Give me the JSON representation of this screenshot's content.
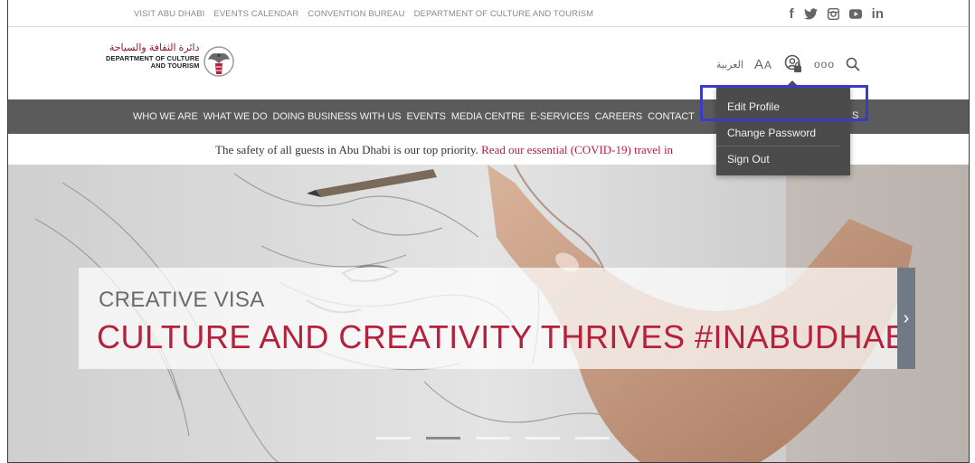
{
  "topbar": {
    "links": [
      "VISIT ABU DHABI",
      "EVENTS CALENDAR",
      "CONVENTION BUREAU",
      "DEPARTMENT OF CULTURE AND TOURISM"
    ],
    "social_icons": [
      "facebook-icon",
      "twitter-icon",
      "instagram-icon",
      "youtube-icon",
      "linkedin-icon"
    ],
    "linkedin_label": "in",
    "facebook_label": "f"
  },
  "header": {
    "logo": {
      "arabic": "دائرة الثقافة والسياحة",
      "line1": "DEPARTMENT OF CULTURE",
      "line2": "AND TOURISM"
    },
    "language": "العربية",
    "font_size_label_large": "A",
    "font_size_label_small": "A",
    "more_label": "ooo"
  },
  "nav": {
    "items": [
      "WHO WE ARE",
      "WHAT WE DO",
      "DOING BUSINESS WITH US",
      "EVENTS",
      "MEDIA CENTRE",
      "E-SERVICES",
      "CAREERS",
      "CONTACT US",
      "ACCESSIBILITY OPTIONS"
    ],
    "visible_fragments": {
      "contact_partial": "CONTACT",
      "last_partial": "S"
    }
  },
  "notice": {
    "text": "The safety of all guests in Abu Dhabi is our top priority. ",
    "link": "Read our essential (COVID-19) travel in"
  },
  "hero": {
    "subtitle": "CREATIVE VISA",
    "title": "CULTURE AND CREATIVITY THRIVES #INABUDHABI",
    "next_arrow": "›",
    "slides": 5,
    "active_slide": 2
  },
  "user_menu": {
    "items": [
      "Edit Profile",
      "Change Password",
      "Sign Out"
    ],
    "highlighted": "Edit Profile"
  },
  "colors": {
    "brand_red": "#b5203a",
    "nav_bg": "#5b5b5b",
    "dropdown_bg": "#4b4b4b",
    "highlight": "#3b3bc4"
  }
}
